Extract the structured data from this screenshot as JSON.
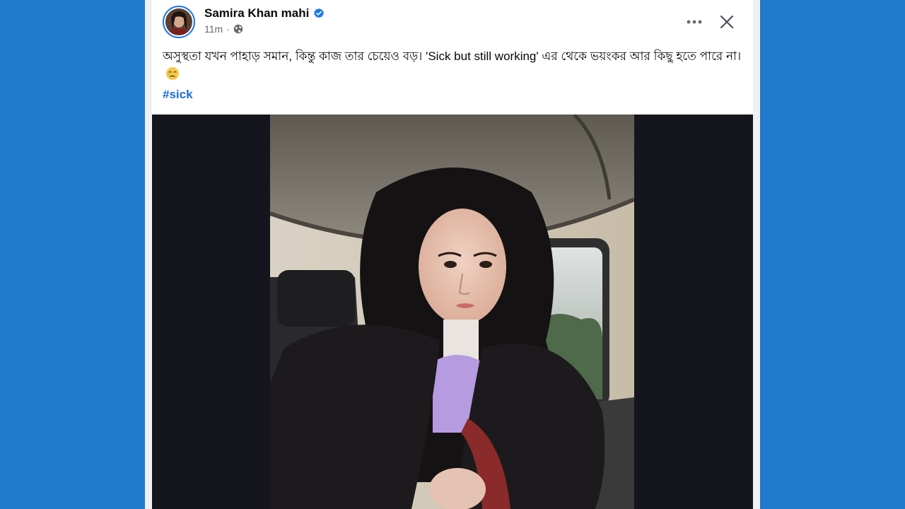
{
  "post": {
    "author": "Samira Khan mahi",
    "verified": true,
    "time": "11m",
    "separator": "·",
    "audience_icon": "globe-icon",
    "text": "অসুস্থতা যখন পাহাড় সমান, কিন্তু কাজ তার চেয়েও বড়। 'Sick but still working' এর থেকে ভয়ংকর আর কিছু হতে পারে না।",
    "emoji_icon": "crying-face-emoji",
    "hashtag": "#sick",
    "actions": {
      "more_icon": "more-options-icon",
      "close_icon": "close-icon"
    }
  },
  "colors": {
    "background": "#1f7bcb",
    "card": "#ffffff",
    "link": "#1a6ed8",
    "verified": "#1877f2",
    "media_background": "#15151d"
  }
}
